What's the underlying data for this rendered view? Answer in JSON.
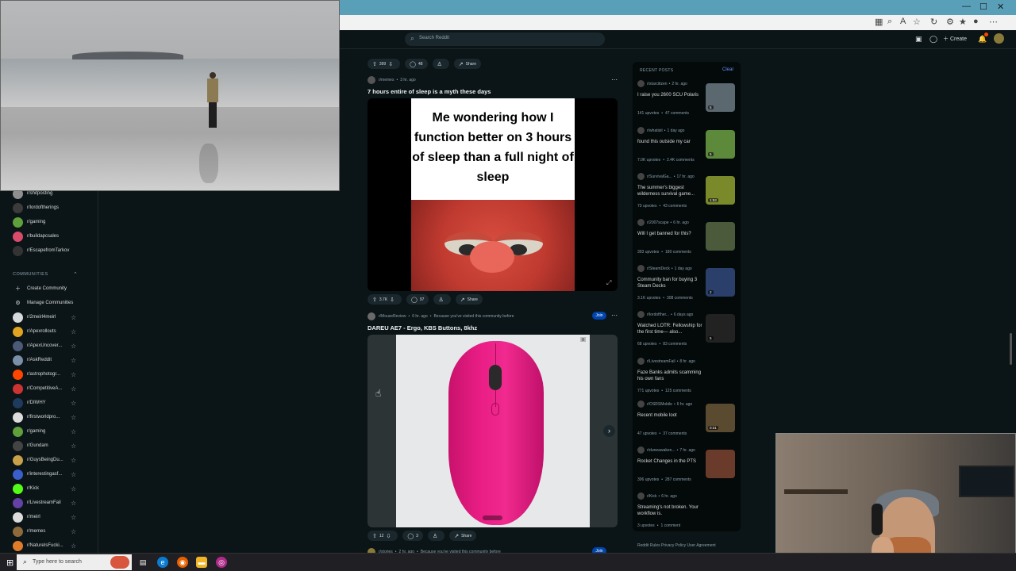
{
  "browser": {
    "window_controls": [
      "—",
      "☐",
      "✕"
    ]
  },
  "reddit_header": {
    "search_placeholder": "Search Reddit",
    "create_label": "Create"
  },
  "post_top_partial": {
    "votes": "399",
    "comments": "48",
    "share_label": "Share"
  },
  "sidebar": {
    "top_items": [
      {
        "label": "r/shitposting",
        "color": "#8f8f8f"
      },
      {
        "label": "r/lordoftherings",
        "color": "#3b3b3b"
      },
      {
        "label": "r/gaming",
        "color": "#5f9f3c"
      },
      {
        "label": "r/buildapcsales",
        "color": "#d94b6b"
      },
      {
        "label": "r/EscapefromTarkov",
        "color": "#333333"
      }
    ],
    "communities_header": "COMMUNITIES",
    "create_community": "Create Community",
    "manage_communities": "Manage Communities",
    "communities": [
      {
        "label": "r/2meirl4meirl",
        "color": "#d7dadc"
      },
      {
        "label": "r/Apexrollouts",
        "color": "#e0a422"
      },
      {
        "label": "r/ApexUncover...",
        "color": "#4a5a78"
      },
      {
        "label": "r/AskReddit",
        "color": "#7a8fa8"
      },
      {
        "label": "r/astrophotogr...",
        "color": "#ff4500"
      },
      {
        "label": "r/CompetitiveA...",
        "color": "#cc3333"
      },
      {
        "label": "r/DIWHY",
        "color": "#1e3a5c"
      },
      {
        "label": "r/firstworldpro...",
        "color": "#dcdcdc"
      },
      {
        "label": "r/gaming",
        "color": "#5f9f3c"
      },
      {
        "label": "r/Gundam",
        "color": "#444444"
      },
      {
        "label": "r/GuysBeingDu...",
        "color": "#c9a14a"
      },
      {
        "label": "r/interestingasf...",
        "color": "#3a5fcd"
      },
      {
        "label": "r/Kick",
        "color": "#53fc18"
      },
      {
        "label": "r/LivestreamFail",
        "color": "#6441a5"
      },
      {
        "label": "r/meirl",
        "color": "#dcdcdc"
      },
      {
        "label": "r/memes",
        "color": "#8c6a3c"
      },
      {
        "label": "r/NatureIsFucki...",
        "color": "#e07b2a"
      }
    ]
  },
  "feed": {
    "post1": {
      "subreddit": "r/memes",
      "time": "3 hr. ago",
      "title": "7 hours entire of sleep is a myth these days",
      "meme_text": "Me wondering how I function better on 3 hours of sleep than a full night of sleep",
      "votes": "3.7K",
      "comments": "97",
      "share_label": "Share"
    },
    "post2": {
      "subreddit": "r/MouseReview",
      "time": "6 hr. ago",
      "reason": "Because you've visited this community before",
      "join_label": "Join",
      "title": "DAREU AE7 - Ergo, KBS Buttons, 8khz",
      "votes": "12",
      "comments": "3",
      "share_label": "Share"
    },
    "post3": {
      "subreddit": "r/stories",
      "time": "2 hr. ago",
      "reason": "Because you've visited this community before",
      "join_label": "Join"
    }
  },
  "recent_posts": {
    "header": "RECENT POSTS",
    "clear_label": "Clear",
    "items": [
      {
        "sub": "r/starcitizen",
        "time": "2 hr. ago",
        "title": "I raise you 2600 SCU Polaris",
        "upvotes": "141 upvotes",
        "comments": "47 comments",
        "thumb": "#5c6870",
        "badge": "5"
      },
      {
        "sub": "r/whatisit",
        "time": "1 day ago",
        "title": "found this outside my car",
        "upvotes": "7.0K upvotes",
        "comments": "2.4K comments",
        "thumb": "#5c8a3a",
        "badge": "5"
      },
      {
        "sub": "r/SurvivalGa...",
        "time": "17 hr. ago",
        "title": "The summer's biggest wilderness survival game...",
        "upvotes": "73 upvotes",
        "comments": "43 comments",
        "thumb": "#7a8a2a",
        "badge": "1:53"
      },
      {
        "sub": "r/2007scape",
        "time": "6 hr. ago",
        "title": "Will I get banned for this?",
        "upvotes": "393 upvotes",
        "comments": "180 comments",
        "thumb": "#4a5a3a",
        "badge": ""
      },
      {
        "sub": "r/SteamDeck",
        "time": "1 day ago",
        "title": "Community ban for buying 3 Steam Decks",
        "upvotes": "3.1K upvotes",
        "comments": "308 comments",
        "thumb": "#2a3f6a",
        "badge": "2"
      },
      {
        "sub": "r/lordofther...",
        "time": "6 days ago",
        "title": "Watched LOTR: Fellowship for the first time— also...",
        "upvotes": "68 upvotes",
        "comments": "83 comments",
        "thumb": "#222222",
        "badge": "5"
      },
      {
        "sub": "r/LivestreamFail",
        "time": "8 hr. ago",
        "title": "Faze Banks admits scamming his own fans",
        "upvotes": "771 upvotes",
        "comments": "125 comments",
        "thumb": "",
        "badge": ""
      },
      {
        "sub": "r/OSRSMobile",
        "time": "6 hr. ago",
        "title": "Recent mobile loot",
        "upvotes": "47 upvotes",
        "comments": "37 comments",
        "thumb": "#5a4a30",
        "badge": "0:31"
      },
      {
        "sub": "r/duneawaken...",
        "time": "7 hr. ago",
        "title": "Rocket Changes in the PTS",
        "upvotes": "306 upvotes",
        "comments": "287 comments",
        "thumb": "#6a3a2a",
        "badge": ""
      },
      {
        "sub": "r/Kick",
        "time": "6 hr. ago",
        "title": "Streaming's not broken. Your workflow is.",
        "upvotes": "3 upvotes",
        "comments": "1 comment",
        "thumb": "",
        "badge": ""
      }
    ],
    "footer": "Reddit Rules  Privacy Policy  User Agreement"
  },
  "taskbar": {
    "search_placeholder": "Type here to search"
  }
}
